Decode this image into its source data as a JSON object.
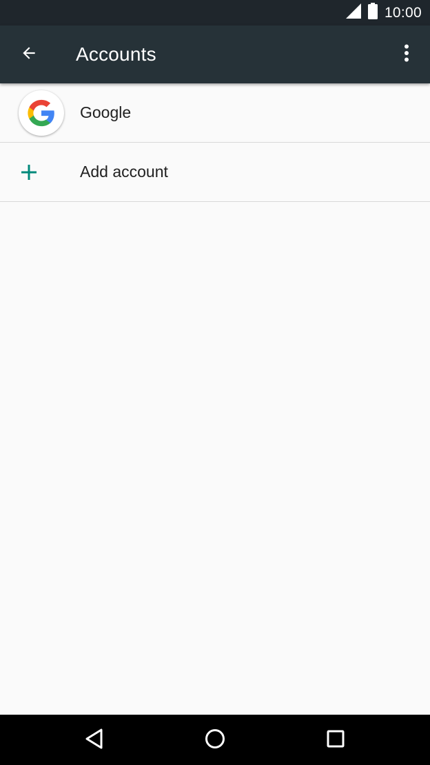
{
  "status_bar": {
    "time": "10:00",
    "icons": [
      "signal-icon",
      "battery-icon"
    ]
  },
  "toolbar": {
    "title": "Accounts",
    "back_icon": "arrow-back-icon",
    "menu_icon": "more-vert-icon",
    "background_color": "#263238"
  },
  "accounts": [
    {
      "label": "Google",
      "icon": "google-icon"
    }
  ],
  "add_account": {
    "label": "Add account",
    "icon": "plus-icon",
    "accent_color": "#00897b"
  },
  "nav_bar": {
    "icons": [
      "back-triangle-icon",
      "home-circle-icon",
      "recents-square-icon"
    ]
  }
}
